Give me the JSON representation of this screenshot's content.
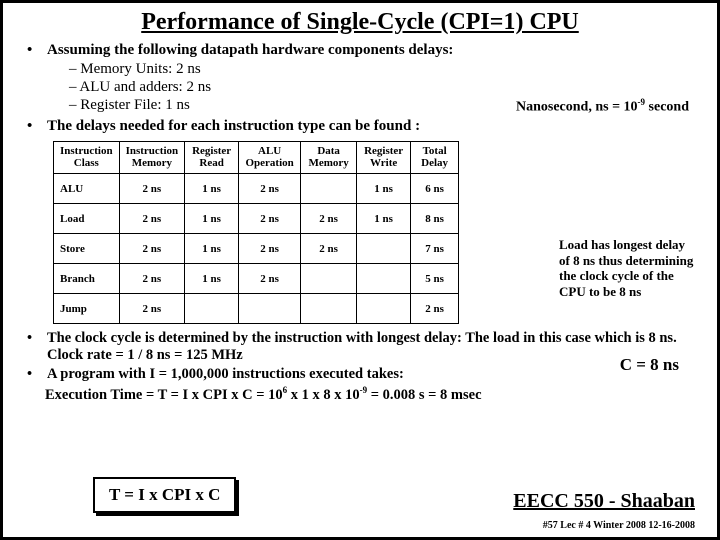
{
  "title": "Performance of Single-Cycle  (CPI=1)  CPU",
  "b1": "Assuming the following datapath hardware components delays:",
  "sub1": "–   Memory Units:  2 ns",
  "sub2": "–   ALU and adders:  2 ns",
  "sub3": "–   Register File:  1 ns",
  "nano_pre": "Nanosecond, ns  =  10",
  "nano_exp": "-9",
  "nano_post": " second",
  "b2": "The delays needed for each instruction type can be found :",
  "h0a": "Instruction",
  "h0b": "Class",
  "h1a": "Instruction",
  "h1b": "Memory",
  "h2a": "Register",
  "h2b": "Read",
  "h3a": "ALU",
  "h3b": "Operation",
  "h4a": "Data",
  "h4b": "Memory",
  "h5a": "Register",
  "h5b": "Write",
  "h6a": "Total",
  "h6b": "Delay",
  "rows": [
    {
      "c0": "ALU",
      "c1": "2 ns",
      "c2": "1 ns",
      "c3": "2 ns",
      "c4": "",
      "c5": "1 ns",
      "c6": "6 ns"
    },
    {
      "c0": "Load",
      "c1": "2 ns",
      "c2": "1 ns",
      "c3": "2 ns",
      "c4": "2 ns",
      "c5": "1 ns",
      "c6": "8 ns"
    },
    {
      "c0": "Store",
      "c1": "2 ns",
      "c2": "1 ns",
      "c3": "2 ns",
      "c4": "2 ns",
      "c5": "",
      "c6": "7 ns"
    },
    {
      "c0": "Branch",
      "c1": "2 ns",
      "c2": "1 ns",
      "c3": "2 ns",
      "c4": "",
      "c5": "",
      "c6": "5 ns"
    },
    {
      "c0": "Jump",
      "c1": "2 ns",
      "c2": "",
      "c3": "",
      "c4": "",
      "c5": "",
      "c6": "2 ns"
    }
  ],
  "side_note": "Load has longest delay of 8 ns thus determining the clock cycle of the CPU to be 8 ns",
  "c_eq": "C =  8 ns",
  "b3": "The clock cycle is determined by the instruction with longest delay:   The load in this case which is 8 ns.   Clock rate =  1 / 8 ns  =  125 MHz",
  "b4": "A program with I = 1,000,000 instructions executed takes:",
  "exec_pre": "Execution Time  =  T  =  I  x CPI  x C =  10",
  "exec_e1": "6",
  "exec_mid": "   x  1  x   8 x 10",
  "exec_e2": "-9",
  "exec_post": "  =  0.008 s = 8 msec",
  "formula": "T = I x CPI x C",
  "course": "EECC 550 - Shaaban",
  "footer": "#57  Lec # 4   Winter 2008   12-16-2008"
}
